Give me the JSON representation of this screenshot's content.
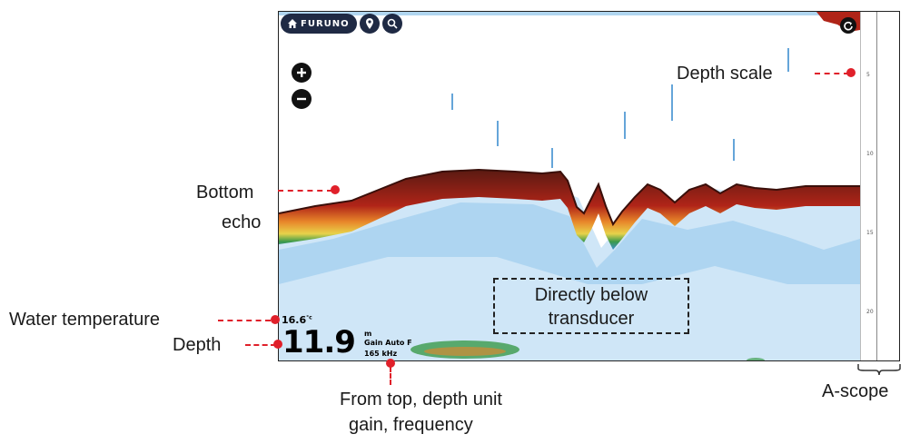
{
  "toolbar": {
    "brand": "FURUNO",
    "home_icon": "home-icon",
    "waypoint_icon": "location-pin-icon",
    "search_icon": "search-icon"
  },
  "zoom": {
    "in_icon": "plus-icon",
    "out_icon": "minus-icon"
  },
  "refresh_icon": "refresh-icon",
  "readouts": {
    "water_temp": "16.6",
    "temp_unit": "°c",
    "depth": "11.9",
    "depth_unit": "m",
    "gain": "Gain Auto F",
    "frequency": "165 kHz"
  },
  "scale_ticks": [
    "5",
    "10",
    "15",
    "20"
  ],
  "annotations": {
    "depth_scale": "Depth scale",
    "bottom_echo_line1": "Bottom",
    "bottom_echo_line2": "echo",
    "water_temperature": "Water temperature",
    "depth": "Depth",
    "directly_below_line1": "Directly below",
    "directly_below_line2": "transducer",
    "from_top_line1": "From top, depth unit",
    "from_top_line2": "gain, frequency",
    "a_scope": "A-scope"
  },
  "colors": {
    "bottom_dark": "#5a1a12",
    "bottom_red": "#c0281c",
    "bottom_orange": "#e8862a",
    "bottom_yellow": "#e8d24a",
    "bottom_green": "#3a9a4a",
    "scatter_blue": "#3f8fd0",
    "scatter_light": "#a9d3f0",
    "leader_red": "#e0202a",
    "button_navy": "#1f2a44"
  }
}
